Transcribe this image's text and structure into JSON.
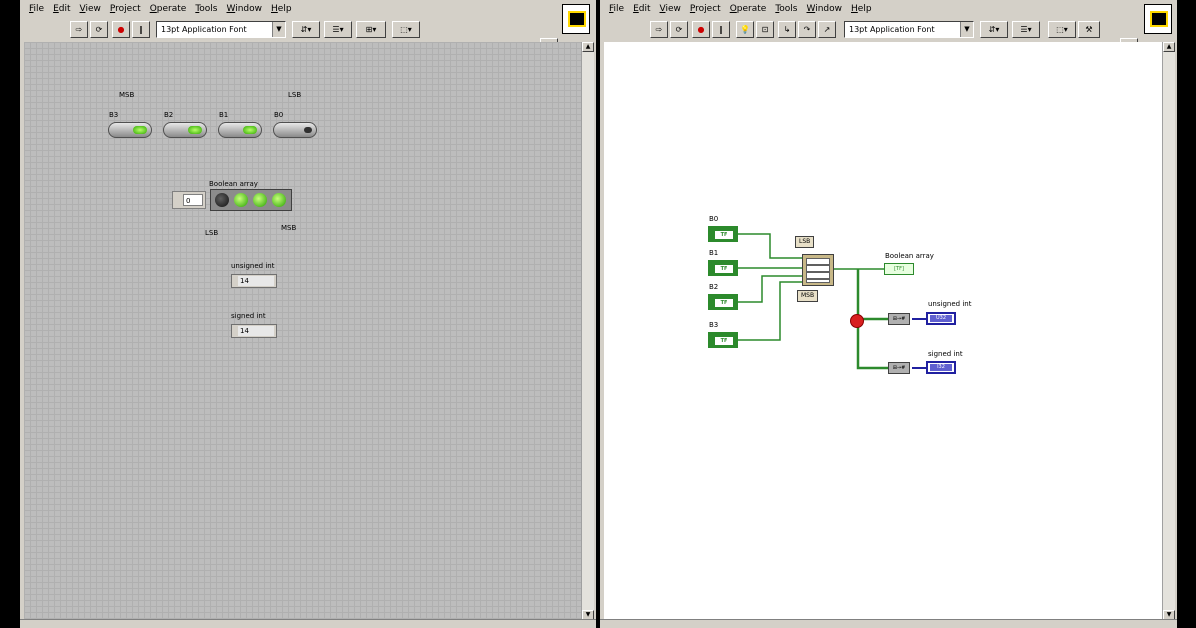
{
  "front_panel": {
    "menu": [
      "File",
      "Edit",
      "View",
      "Project",
      "Operate",
      "Tools",
      "Window",
      "Help"
    ],
    "font_selector": "13pt Application Font",
    "msb_label": "MSB",
    "lsb_label": "LSB",
    "switches": [
      {
        "label": "B3",
        "state": "on"
      },
      {
        "label": "B2",
        "state": "on"
      },
      {
        "label": "B1",
        "state": "on"
      },
      {
        "label": "B0",
        "state": "off"
      }
    ],
    "array_label": "Boolean array",
    "array_index": "0",
    "array_leds": [
      "off",
      "on",
      "on",
      "on"
    ],
    "array_lsb": "LSB",
    "array_msb": "MSB",
    "unsigned_label": "unsigned int",
    "unsigned_value": "14",
    "signed_label": "signed int",
    "signed_value": "14"
  },
  "block_diagram": {
    "menu": [
      "File",
      "Edit",
      "View",
      "Project",
      "Operate",
      "Tools",
      "Window",
      "Help"
    ],
    "font_selector": "13pt Application Font",
    "terminals": [
      {
        "label": "B0",
        "type": "TF"
      },
      {
        "label": "B1",
        "type": "TF"
      },
      {
        "label": "B2",
        "type": "TF"
      },
      {
        "label": "B3",
        "type": "TF"
      }
    ],
    "const_lsb": "LSB",
    "const_msb": "MSB",
    "array_terminal_label": "Boolean array",
    "array_terminal_type": "[TF]",
    "unsigned_label": "unsigned int",
    "unsigned_type": "U32",
    "signed_label": "signed int",
    "signed_type": "I32"
  }
}
